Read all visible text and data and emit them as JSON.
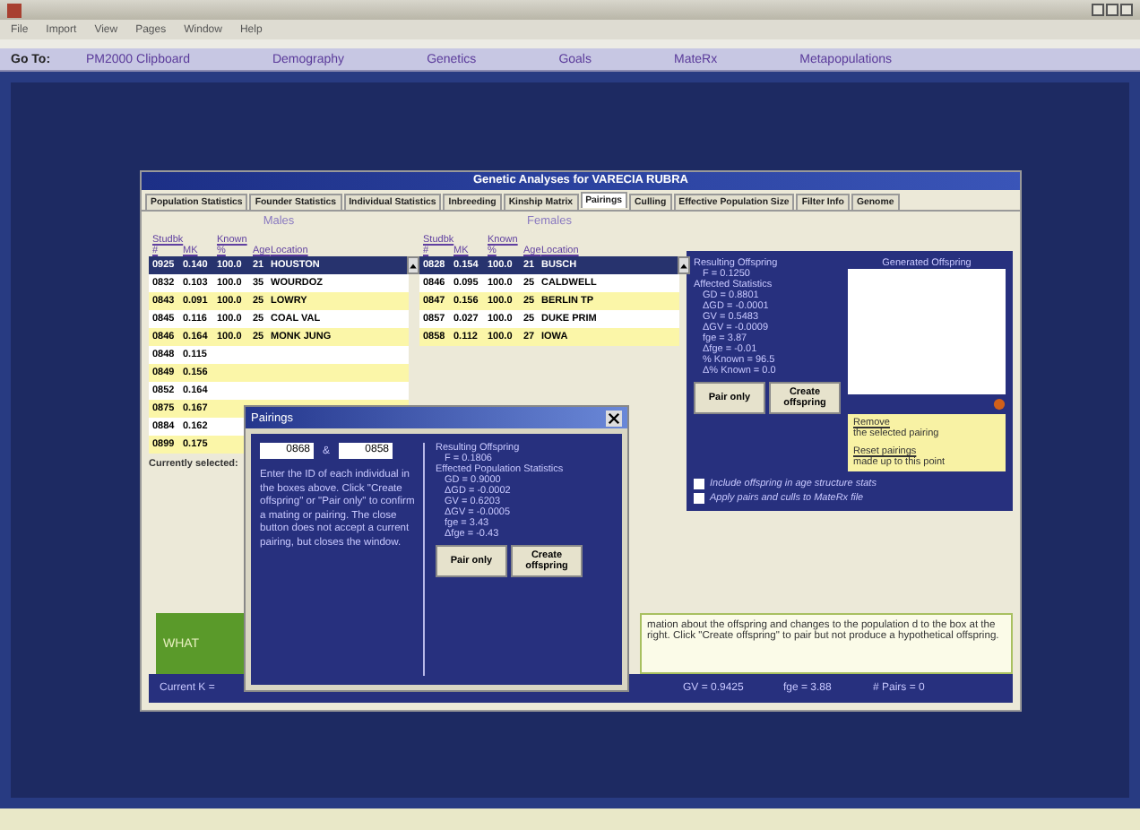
{
  "menu": [
    "File",
    "Import",
    "View",
    "Pages",
    "Window",
    "Help"
  ],
  "nav": {
    "label": "Go To:",
    "items": [
      "PM2000 Clipboard",
      "Demography",
      "Genetics",
      "Goals",
      "MateRx",
      "Metapopulations"
    ]
  },
  "window": {
    "title": "Genetic Analyses for VARECIA RUBRA",
    "tabs": [
      {
        "label": "Population Statistics",
        "selected": false
      },
      {
        "label": "Founder Statistics",
        "selected": false
      },
      {
        "label": "Individual Statistics",
        "selected": false
      },
      {
        "label": "Inbreeding",
        "selected": false
      },
      {
        "label": "Kinship Matrix",
        "selected": false
      },
      {
        "label": "Pairings",
        "selected": true
      },
      {
        "label": "Culling",
        "selected": false
      },
      {
        "label": "Effective Population Size",
        "selected": false
      },
      {
        "label": "Filter Info",
        "selected": false
      },
      {
        "label": "Genome",
        "selected": false
      }
    ],
    "lists": [
      {
        "title": "Males",
        "columns": [
          "Studbk #",
          "MK",
          "Known %",
          "Age",
          "Location"
        ],
        "rows": [
          {
            "cells": [
              "0925",
              "0.140",
              "100.0",
              "21",
              "HOUSTON"
            ],
            "selected": true
          },
          {
            "cells": [
              "0832",
              "0.103",
              "100.0",
              "35",
              "WOURDOZ"
            ],
            "selected": false
          },
          {
            "cells": [
              "0843",
              "0.091",
              "100.0",
              "25",
              "LOWRY"
            ],
            "selected": false
          },
          {
            "cells": [
              "0845",
              "0.116",
              "100.0",
              "25",
              "COAL VAL"
            ],
            "selected": false
          },
          {
            "cells": [
              "0846",
              "0.164",
              "100.0",
              "25",
              "MONK JUNG"
            ],
            "selected": false
          },
          {
            "cells": [
              "0848",
              "0.115"
            ],
            "selected": false
          },
          {
            "cells": [
              "0849",
              "0.156"
            ],
            "selected": false
          },
          {
            "cells": [
              "0852",
              "0.164"
            ],
            "selected": false
          },
          {
            "cells": [
              "0875",
              "0.167"
            ],
            "selected": false
          },
          {
            "cells": [
              "0884",
              "0.162"
            ],
            "selected": false
          },
          {
            "cells": [
              "0899",
              "0.175"
            ],
            "selected": false
          }
        ]
      },
      {
        "title": "Females",
        "columns": [
          "Studbk #",
          "MK",
          "Known %",
          "Age",
          "Location"
        ],
        "rows": [
          {
            "cells": [
              "0828",
              "0.154",
              "100.0",
              "21",
              "BUSCH"
            ],
            "selected": true
          },
          {
            "cells": [
              "0846",
              "0.095",
              "100.0",
              "25",
              "CALDWELL"
            ],
            "selected": false
          },
          {
            "cells": [
              "0847",
              "0.156",
              "100.0",
              "25",
              "BERLIN TP"
            ],
            "selected": false
          },
          {
            "cells": [
              "0857",
              "0.027",
              "100.0",
              "25",
              "DUKE PRIM"
            ],
            "selected": false
          },
          {
            "cells": [
              "0858",
              "0.112",
              "100.0",
              "27",
              "IOWA"
            ],
            "selected": false
          }
        ]
      }
    ],
    "current_label": "Currently selected:",
    "summary": [
      {
        "text": "Resulting Offspring",
        "kind": "heading"
      },
      {
        "text": "F = 0.1250",
        "kind": "stat"
      },
      {
        "text": "Affected Statistics",
        "kind": "heading"
      },
      {
        "text": "GD = 0.8801",
        "kind": "stat"
      },
      {
        "text": "ΔGD = -0.0001",
        "kind": "stat"
      },
      {
        "text": "GV = 0.5483",
        "kind": "stat"
      },
      {
        "text": "ΔGV = -0.0009",
        "kind": "stat"
      },
      {
        "text": "fge = 3.87",
        "kind": "stat"
      },
      {
        "text": "Δfge = -0.01",
        "kind": "stat"
      },
      {
        "text": "% Known = 96.5",
        "kind": "stat"
      },
      {
        "text": "Δ% Known = 0.0",
        "kind": "stat"
      }
    ],
    "buttons": [
      "Pair only",
      "Create offspring"
    ],
    "offspring_title": "Generated Offspring",
    "notes": [
      {
        "link": "Remove",
        "text": "the selected pairing"
      },
      {
        "link": "Reset pairings",
        "text": "made up to this point"
      }
    ],
    "checkboxes": [
      {
        "label": "Include offspring in age structure stats",
        "checked": false
      },
      {
        "label": "Apply pairs and culls to MateRx file",
        "checked": false
      }
    ],
    "help_button": "WHAT",
    "help_text": "mation about the offspring and changes to the population d to the box at the right. Click \"Create offspring\" to pair but not produce a hypothetical offspring.",
    "status": [
      "Current K =",
      "GV = 0.9425",
      "fge = 3.88",
      "# Pairs = 0"
    ]
  },
  "dialog": {
    "title": "Pairings",
    "ids": [
      "0868",
      "0858"
    ],
    "separator": "&",
    "instructions": "Enter the ID of each individual in the boxes above. Click \"Create offspring\" or \"Pair only\" to confirm a mating or pairing. The close button does not accept a current pairing, but closes the window.",
    "summary": [
      {
        "text": "Resulting Offspring",
        "kind": "heading"
      },
      {
        "text": "F = 0.1806",
        "kind": "stat"
      },
      {
        "text": "Effected Population Statistics",
        "kind": "heading"
      },
      {
        "text": "GD = 0.9000",
        "kind": "stat"
      },
      {
        "text": "ΔGD = -0.0002",
        "kind": "stat"
      },
      {
        "text": "GV = 0.6203",
        "kind": "stat"
      },
      {
        "text": "ΔGV = -0.0005",
        "kind": "stat"
      },
      {
        "text": "fge = 3.43",
        "kind": "stat"
      },
      {
        "text": "Δfge = -0.43",
        "kind": "stat"
      }
    ],
    "buttons": [
      "Pair only",
      "Create offspring"
    ]
  }
}
